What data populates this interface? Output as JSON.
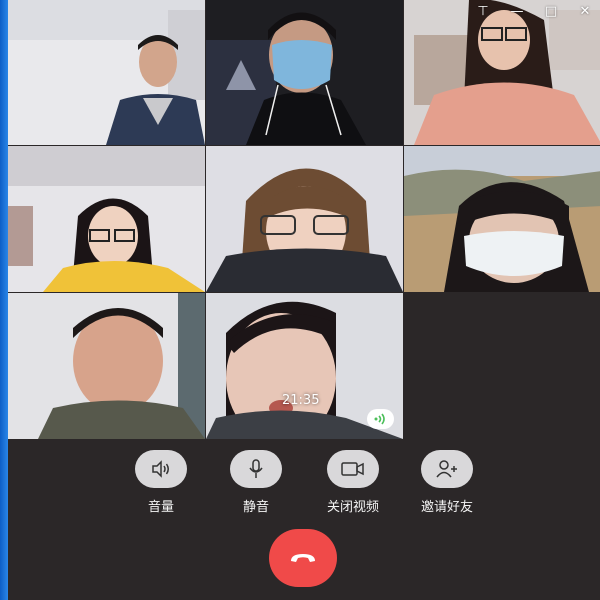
{
  "window_controls": {
    "pin": "⊤",
    "minimize": "—",
    "maximize": "□",
    "close": "✕"
  },
  "call": {
    "timer": "21:35"
  },
  "controls": [
    {
      "label": "音量",
      "icon": "speaker-icon"
    },
    {
      "label": "静音",
      "icon": "microphone-icon"
    },
    {
      "label": "关闭视频",
      "icon": "video-camera-icon"
    },
    {
      "label": "邀请好友",
      "icon": "add-person-icon"
    }
  ],
  "hangup": {
    "icon": "phone-hangup-icon",
    "color": "#f04a49"
  },
  "colors": {
    "window_bg": "#2b2728",
    "control_button": "#d9d8da",
    "speaking_indicator": "#4cbf5a"
  },
  "participants": [
    {
      "tile": 1,
      "desc": "man in dark suit"
    },
    {
      "tile": 2,
      "desc": "person with blue mask"
    },
    {
      "tile": 3,
      "desc": "woman with glasses in pink sweater"
    },
    {
      "tile": 4,
      "desc": "girl with glasses in yellow jacket"
    },
    {
      "tile": 5,
      "desc": "girl with short hair and glasses"
    },
    {
      "tile": 6,
      "desc": "woman with white mask outdoors"
    },
    {
      "tile": 7,
      "desc": "man in olive jacket"
    },
    {
      "tile": 8,
      "desc": "woman speaking"
    }
  ]
}
